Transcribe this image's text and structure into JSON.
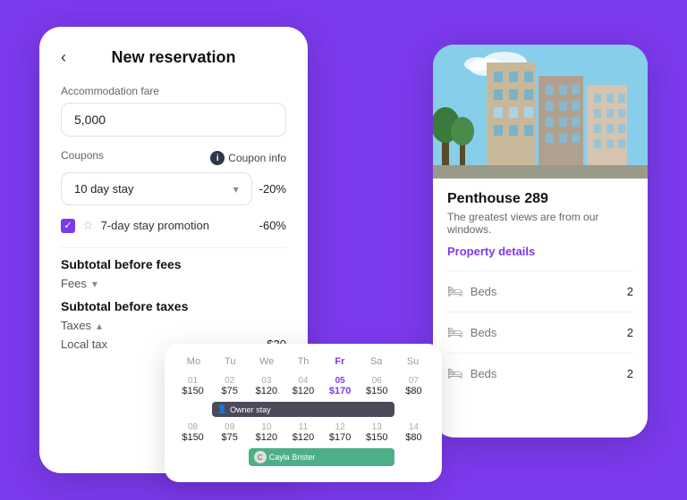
{
  "background": {
    "color": "#7c3aed"
  },
  "left_card": {
    "title": "New reservation",
    "back_label": "‹",
    "accommodation_label": "Accommodation fare",
    "accommodation_value": "5,000",
    "coupons_label": "Coupons",
    "coupon_info_label": "Coupon info",
    "coupon_option": "10 day stay",
    "coupon_discount": "-20%",
    "promo_label": "7-day stay promotion",
    "promo_discount": "-60%",
    "subtotal_before_fees": "Subtotal before fees",
    "fees_label": "Fees",
    "subtotal_before_taxes": "Subtotal before taxes",
    "taxes_label": "Taxes",
    "local_tax_label": "Local tax",
    "local_tax_value": "$20"
  },
  "calendar": {
    "day_names": [
      "Mo",
      "Tu",
      "We",
      "Th",
      "Fr",
      "Sa",
      "Su"
    ],
    "week1": [
      {
        "date": "01",
        "price": "$150"
      },
      {
        "date": "02",
        "price": "$75"
      },
      {
        "date": "03",
        "price": "$120"
      },
      {
        "date": "04",
        "price": "$120"
      },
      {
        "date": "05",
        "price": "$170",
        "highlight": true
      },
      {
        "date": "06",
        "price": "$150"
      },
      {
        "date": "07",
        "price": "$80"
      }
    ],
    "week2": [
      {
        "date": "08",
        "price": "$150"
      },
      {
        "date": "09",
        "price": "$75"
      },
      {
        "date": "10",
        "price": "$120"
      },
      {
        "date": "11",
        "price": "$120"
      },
      {
        "date": "12",
        "price": "$170"
      },
      {
        "date": "13",
        "price": "$150"
      },
      {
        "date": "14",
        "price": "$80"
      }
    ],
    "owner_stay_label": "Owner stay",
    "cayla_label": "Cayla Brister"
  },
  "right_card": {
    "property_name": "Penthouse 289",
    "property_desc": "The greatest views are from our windows.",
    "property_details_label": "Property details",
    "beds_label": "Beds",
    "beds_values": [
      "2",
      "2",
      "2"
    ]
  }
}
